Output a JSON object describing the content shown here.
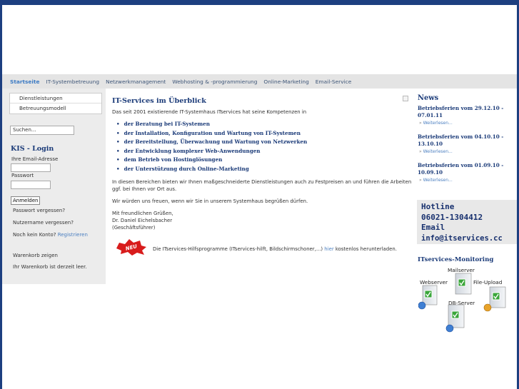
{
  "nav": {
    "items": [
      "Startseite",
      "IT-Systembetreuung",
      "Netzwerkmanagement",
      "Webhosting & -programmierung",
      "Online-Marketing",
      "Email-Service"
    ]
  },
  "sidebar": {
    "menu": [
      "Dienstleistungen",
      "Betreuungsmodell"
    ],
    "search_value": "Suchen...",
    "login": {
      "title": "KIS - Login",
      "email_label": "Ihre Email-Adresse",
      "password_label": "Passwort",
      "button": "Anmelden",
      "forgot_password": "Passwort vergessen?",
      "forgot_username": "Nutzername vergessen?",
      "no_account": "Noch kein Konto?",
      "register": "Registrieren"
    },
    "cart": {
      "show": "Warenkorb zeigen",
      "empty": "Ihr Warenkorb ist derzeit leer."
    }
  },
  "main": {
    "title": "IT-Services im Überblick",
    "intro": "Das seit 2001 existierende IT-Systemhaus ITservices hat seine Kompetenzen in",
    "list": [
      "der Beratung bei IT-Systemen",
      "der Installation, Konfiguration und Wartung von IT-Systemen",
      "der Bereitstellung, Überwachung und Wartung  von Netzwerken",
      "der Entwicklung komplexer Web-Anwendungen",
      "dem Betrieb von Hostinglösungen",
      "der Unterstützung durch Online-Marketing"
    ],
    "para1": "In diesen Bereichen bieten wir Ihnen maßgeschneiderte Dienstleistungen auch zu Festpreisen an und führen die Arbeiten ggf. bei Ihnen vor Ort aus.",
    "para2": "Wir würden uns freuen, wenn wir Sie in unserem Systemhaus begrüßen dürfen.",
    "sig1": "Mit freundlichen Grüßen,",
    "sig2": "Dr. Daniel Eichelsbacher",
    "sig3": "(Geschäftsführer)",
    "badge": "NEU",
    "download_pre": "Die ITservices-Hilfsprogramme (ITservices-hilft, Bildschirmschoner,...)",
    "download_link": "hier",
    "download_post": "kostenlos herunterladen."
  },
  "right": {
    "news_title": "News",
    "news": [
      {
        "title": "Betriebsferien vom 29.12.10 - 07.01.11",
        "more": "Weiterlesen..."
      },
      {
        "title": "Betriebsferien vom 04.10.10 - 13.10.10",
        "more": "Weiterlesen..."
      },
      {
        "title": "Betriebsferien vom 01.09.10 - 10.09.10",
        "more": "Weiterlesen..."
      }
    ],
    "hotline": {
      "l1": "Hotline",
      "l2": "06021-1304412",
      "l3": "Email",
      "l4": "info@itservices.cc"
    },
    "monitoring": {
      "title": "ITservices-Monitoring",
      "servers": [
        "Mailserver",
        "Webserver",
        "File-Upload",
        "DB-Server"
      ]
    }
  },
  "colors": {
    "background": "#1d3f80",
    "heading": "#1a3a78",
    "link": "#4b7fc0",
    "status_ok": "#3aa63a"
  }
}
